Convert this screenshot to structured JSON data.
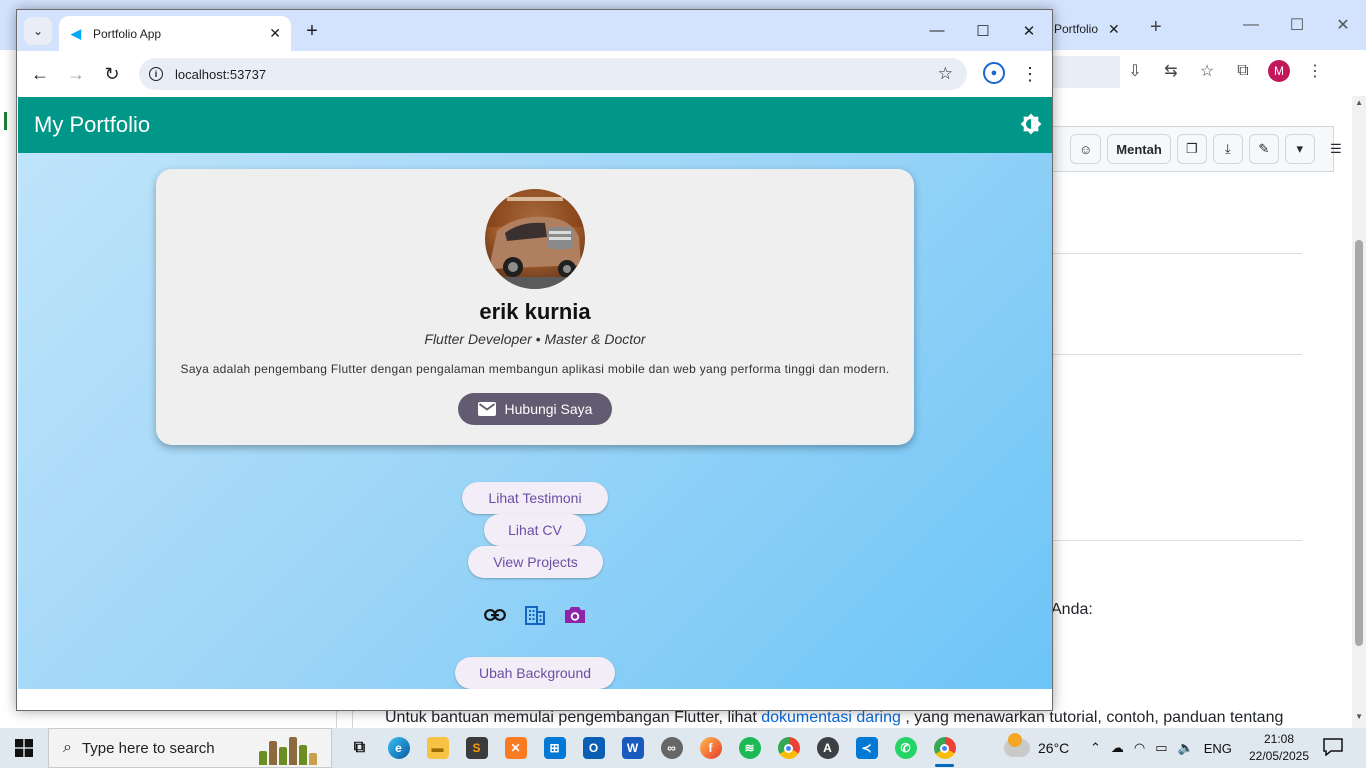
{
  "background_window": {
    "tab_title": "Portfolio",
    "tab_close": "✕",
    "new_tab": "+",
    "avatar_letter": "M",
    "file_toolbar": {
      "raw_label": "Mentah"
    },
    "body_text_anda": "Anda:",
    "bottom_text_before": "Untuk bantuan memulai pengembangan Flutter, lihat ",
    "bottom_link": "dokumentasi daring",
    "bottom_text_after": " , yang menawarkan tutorial, contoh, panduan tentang"
  },
  "browser": {
    "tab_title": "Portfolio App",
    "tab_close": "✕",
    "new_tab": "+",
    "url": "localhost:53737",
    "window_controls": [
      "—",
      "☐",
      "✕"
    ]
  },
  "app": {
    "title": "My Portfolio",
    "theme_icon": "brightness-icon",
    "accent_color": "#009688",
    "profile": {
      "name": "erik kurnia",
      "role": "Flutter Developer • Master & Doctor",
      "bio": "Saya adalah pengembang Flutter dengan pengalaman membangun aplikasi mobile dan web yang performa tinggi dan modern.",
      "contact_label": "Hubungi Saya"
    },
    "buttons": {
      "testimoni": "Lihat Testimoni",
      "cv": "Lihat CV",
      "projects": "View Projects",
      "change_bg": "Ubah Background"
    },
    "social_icons": [
      "link-icon",
      "building-icon",
      "camera-icon"
    ]
  },
  "taskbar": {
    "search_placeholder": "Type here to search",
    "weather_temp": "26°C",
    "language": "ENG",
    "time": "21:08",
    "date": "22/05/2025"
  }
}
